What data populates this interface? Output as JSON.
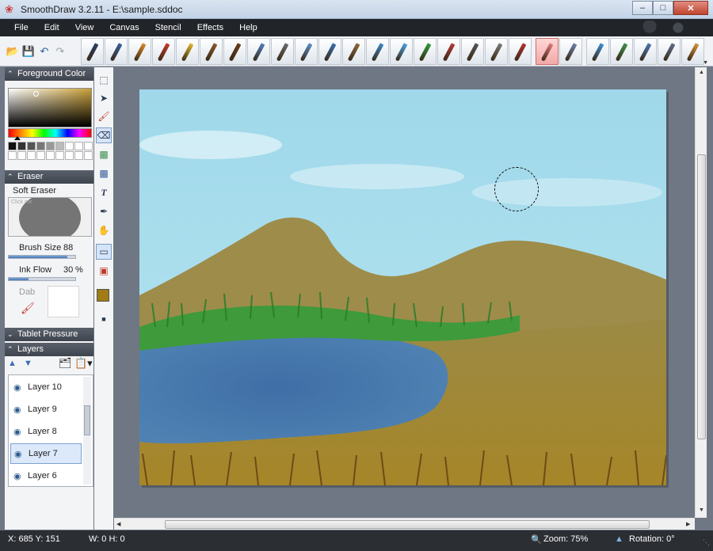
{
  "window": {
    "title": "SmoothDraw 3.2.11 - E:\\sample.sddoc",
    "minimize_glyph": "‒",
    "maximize_glyph": "□",
    "close_glyph": "✕"
  },
  "menu": [
    "File",
    "Edit",
    "View",
    "Canvas",
    "Stencil",
    "Effects",
    "Help"
  ],
  "toolbar": {
    "quick_actions": [
      "open-folder-icon",
      "save-icon",
      "undo-icon",
      "redo-icon"
    ],
    "brushes": [
      {
        "name": "pen",
        "color": "#2a3e66"
      },
      {
        "name": "ink-pen",
        "color": "#3b5d9c"
      },
      {
        "name": "pencil",
        "color": "#d98a2b"
      },
      {
        "name": "red-pencil",
        "color": "#c43a2a"
      },
      {
        "name": "crayon",
        "color": "#e2b62d"
      },
      {
        "name": "brush",
        "color": "#8a5a2b"
      },
      {
        "name": "oil-brush",
        "color": "#6a3d1a"
      },
      {
        "name": "airbrush",
        "color": "#4f7fbe"
      },
      {
        "name": "spray",
        "color": "#6b6b6b"
      },
      {
        "name": "sprinkler",
        "color": "#5d8fc9"
      },
      {
        "name": "water-brush",
        "color": "#3a6fb0"
      },
      {
        "name": "flat-brush",
        "color": "#8a6a3b"
      },
      {
        "name": "paint-bucket",
        "color": "#3c87c8"
      },
      {
        "name": "sparkle",
        "color": "#4aa0e0"
      },
      {
        "name": "grass",
        "color": "#2f9a3a"
      },
      {
        "name": "flower",
        "color": "#b83a3a"
      },
      {
        "name": "net",
        "color": "#555555"
      },
      {
        "name": "texture",
        "color": "#7a7a7a"
      },
      {
        "name": "stamp",
        "color": "#b23030"
      },
      {
        "name": "eraser",
        "color": "#e07a7a"
      },
      {
        "name": "hard-eraser",
        "color": "#6c7fa8"
      },
      {
        "name": "water-drop",
        "color": "#3a8fd8"
      },
      {
        "name": "picture-tube",
        "color": "#3f8f4f"
      },
      {
        "name": "image-stamp",
        "color": "#4b79b5"
      },
      {
        "name": "shape-brush",
        "color": "#5d6e8c"
      },
      {
        "name": "hand-brush",
        "color": "#d4923a"
      }
    ],
    "selected_brush_index": 19
  },
  "foreground": {
    "header": "Foreground Color",
    "swatch_colors": [
      "#111111",
      "#333333",
      "#555555",
      "#777777",
      "#999999",
      "#bbbbbb",
      "#ffffff",
      "#ffffff",
      "#ffffff",
      "#ffffff",
      "#ffffff",
      "#ffffff",
      "#ffffff",
      "#ffffff",
      "#ffffff",
      "#ffffff",
      "#ffffff",
      "#ffffff"
    ]
  },
  "eraser": {
    "header": "Eraser",
    "type": "Soft Eraser",
    "preview_caption": "Click me",
    "brush_size_label": "Brush Size",
    "brush_size_value": "88",
    "brush_size_fraction": 0.88,
    "ink_flow_label": "Ink Flow",
    "ink_flow_value": "30",
    "ink_flow_unit": "%",
    "ink_flow_fraction": 0.3,
    "dab_label": "Dab"
  },
  "tablet": {
    "header": "Tablet Pressure"
  },
  "layers": {
    "header": "Layers",
    "items": [
      {
        "label": "Layer 10",
        "selected": false
      },
      {
        "label": "Layer 9",
        "selected": false
      },
      {
        "label": "Layer 8",
        "selected": false
      },
      {
        "label": "Layer 7",
        "selected": true
      },
      {
        "label": "Layer 6",
        "selected": false
      }
    ]
  },
  "tools": [
    "selection-icon",
    "move-icon",
    "brush-tool-icon",
    "eraser-tool-icon",
    "fill-tool-icon",
    "bucket-tool-icon",
    "text-tool-icon",
    "eyedropper-tool-icon",
    "hand-tool-icon",
    "rectangle-tool-icon",
    "stencil-tool-icon"
  ],
  "colors": {
    "foreground": "#a07c14",
    "background": "#ffffff"
  },
  "status": {
    "cursor": "X: 685 Y: 151",
    "size": "W: 0 H: 0",
    "zoom": "Zoom: 75%",
    "rotation": "Rotation: 0°"
  }
}
